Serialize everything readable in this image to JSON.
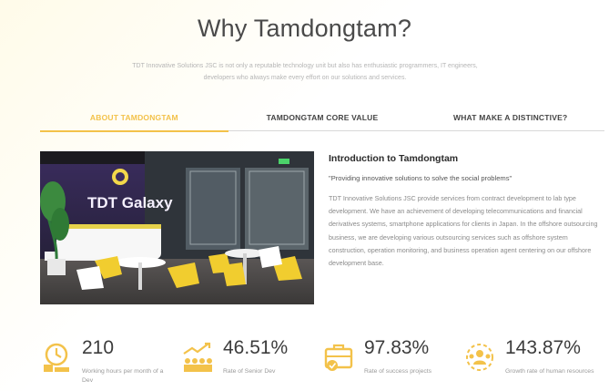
{
  "header": {
    "title": "Why Tamdongtam?",
    "subtitle": "TDT Innovative Solutions JSC is not only a reputable technology unit but also has enthusiastic programmers, IT engineers, developers who always make every effort on our solutions and services."
  },
  "tabs": [
    {
      "label": "ABOUT TAMDONGTAM",
      "active": true
    },
    {
      "label": "TAMDONGTAM CORE VALUE",
      "active": false
    },
    {
      "label": "WHAT MAKE A DISTINCTIVE?",
      "active": false
    }
  ],
  "photo": {
    "sign_text": "TDT Galaxy"
  },
  "intro": {
    "title": "Introduction to Tamdongtam",
    "quote": "\"Providing innovative solutions to solve the social problems\"",
    "body": "TDT Innovative Solutions JSC provide services from contract development to lab type development. We have an achievement of developing telecommunications and financial derivatives systems, smartphone applications for clients in Japan. In the offshore outsourcing business, we are developing various outsourcing services such as offshore system construction, operation monitoring, and business operation agent centering on our offshore development base."
  },
  "stats": [
    {
      "value": "210",
      "label": "Working hours per month of a Dev",
      "icon": "clock-icon"
    },
    {
      "value": "46.51%",
      "label": "Rate of Senior Dev",
      "icon": "team-growth-icon"
    },
    {
      "value": "97.83%",
      "label": "Rate of success projects",
      "icon": "briefcase-icon"
    },
    {
      "value": "143.87%",
      "label": "Growth rate of human resources",
      "icon": "people-growth-icon"
    }
  ],
  "colors": {
    "accent": "#f3c24a",
    "text_dark": "#3c3c3c",
    "text_muted": "#9a9a9a"
  }
}
